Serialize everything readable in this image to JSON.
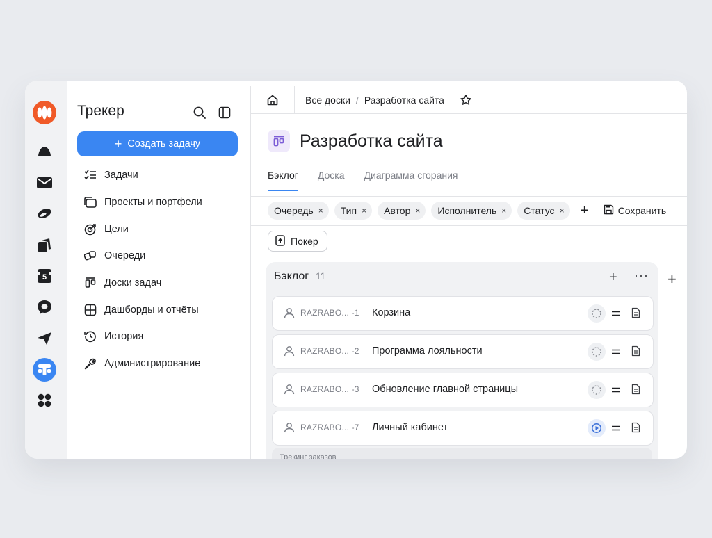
{
  "rail": {
    "icons": [
      "yandex360-logo-icon",
      "cloud-icon",
      "mail-icon",
      "telemost-icon",
      "docs-icon",
      "calendar-icon",
      "messenger-icon",
      "send-icon",
      "tracker-icon",
      "apps-grid-icon"
    ],
    "calendar_day": "5",
    "colors": {
      "logo": "#f05a28",
      "active": "#3a86f2"
    }
  },
  "sidebar": {
    "title": "Трекер",
    "create_button": "Создать задачу",
    "items": [
      {
        "label": "Задачи",
        "icon": "tasks-icon"
      },
      {
        "label": "Проекты и портфели",
        "icon": "projects-icon"
      },
      {
        "label": "Цели",
        "icon": "goals-icon"
      },
      {
        "label": "Очереди",
        "icon": "queues-icon"
      },
      {
        "label": "Доски задач",
        "icon": "boards-icon"
      },
      {
        "label": "Дашборды и отчёты",
        "icon": "dashboards-icon"
      },
      {
        "label": "История",
        "icon": "history-icon"
      },
      {
        "label": "Администрирование",
        "icon": "admin-icon"
      }
    ]
  },
  "breadcrumb": {
    "root": "Все доски",
    "separator": "/",
    "current": "Разработка сайта"
  },
  "page": {
    "title": "Разработка сайта"
  },
  "tabs": [
    {
      "label": "Бэклог",
      "active": true
    },
    {
      "label": "Доска",
      "active": false
    },
    {
      "label": "Диаграмма сгорания",
      "active": false
    }
  ],
  "filters": [
    "Очередь",
    "Тип",
    "Автор",
    "Исполнитель",
    "Статус"
  ],
  "filter_close": "×",
  "add_filter": "+",
  "save_label": "Сохранить",
  "poker_label": "Покер",
  "backlog": {
    "title": "Бэклог",
    "count": "11",
    "add": "+",
    "more": "···",
    "cards": [
      {
        "key": "RAZRABO...",
        "num": "-1",
        "title": "Корзина",
        "status": "open"
      },
      {
        "key": "RAZRABO...",
        "num": "-2",
        "title": "Программа лояльности",
        "status": "open"
      },
      {
        "key": "RAZRABO...",
        "num": "-3",
        "title": "Обновление главной страницы",
        "status": "open"
      },
      {
        "key": "RAZRABO...",
        "num": "-7",
        "title": "Личный кабинет",
        "status": "in-progress"
      }
    ],
    "swimlane": "Трекинг заказов"
  },
  "board_add": "+"
}
